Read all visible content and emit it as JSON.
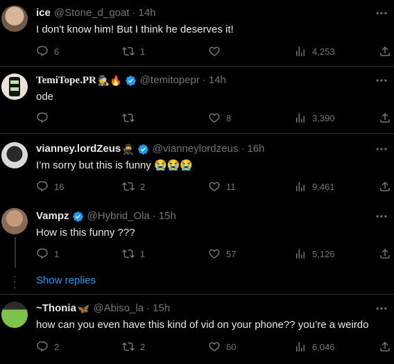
{
  "tweets": [
    {
      "name": "ice",
      "handle": "@Stone_d_goat",
      "time": "14h",
      "text": "I don't know him! But I think he deserves it!",
      "replies": "6",
      "retweets": "1",
      "likes": "",
      "views": "4,253"
    },
    {
      "name": "TemiTope.PR",
      "name_emoji": "🕵🔥",
      "handle": "@temitopepr",
      "time": "14h",
      "text": "ode",
      "replies": "",
      "retweets": "",
      "likes": "8",
      "views": "3,390"
    },
    {
      "name": "vianney.lordZeus",
      "name_emoji": "🥷",
      "handle": "@vianneylordzeus",
      "time": "16h",
      "text": "I’m sorry but this is funny 😭😭😭",
      "replies": "16",
      "retweets": "2",
      "likes": "11",
      "views": "9,461"
    },
    {
      "name": "Vampz",
      "handle": "@Hybrid_Ola",
      "time": "15h",
      "text": "How is this funny ???",
      "replies": "1",
      "retweets": "1",
      "likes": "57",
      "views": "5,126"
    },
    {
      "name": "~Thonia",
      "name_emoji": "🦋",
      "handle": "@Abiso_la",
      "time": "15h",
      "text": "how can you even have this kind of vid on your phone?? you’re a weirdo",
      "replies": "2",
      "retweets": "2",
      "likes": "60",
      "views": "6,046"
    }
  ],
  "separator": "·",
  "show_replies": "Show replies",
  "colors": {
    "background": "#000000",
    "text": "#e7e9ea",
    "secondary": "#71767b",
    "link": "#1d9bf0",
    "verified": "#1d9bf0"
  }
}
